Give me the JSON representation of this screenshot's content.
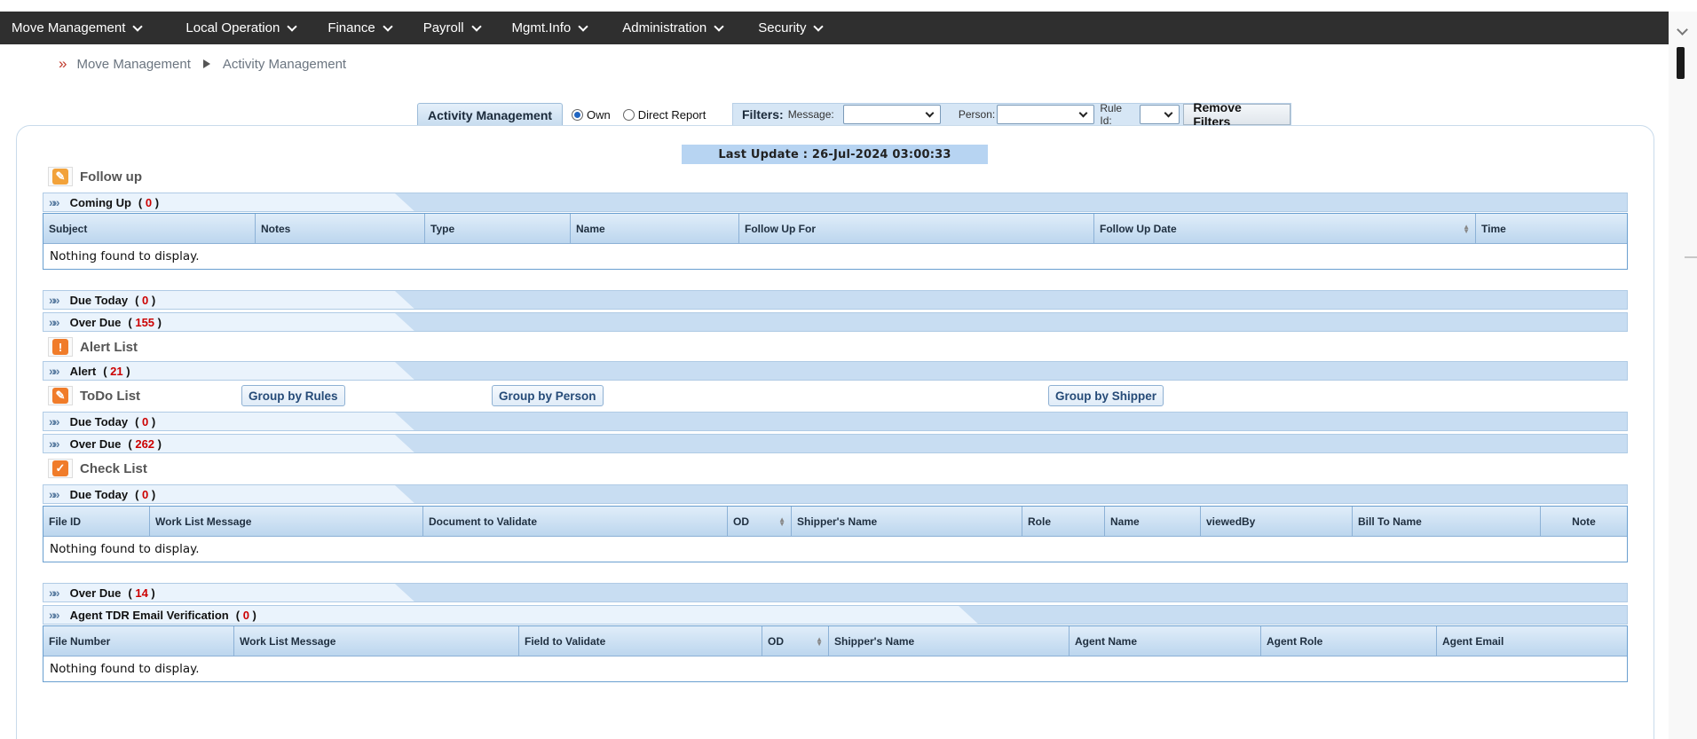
{
  "nav": [
    {
      "label": "Move Management"
    },
    {
      "label": "Local Operation"
    },
    {
      "label": "Finance"
    },
    {
      "label": "Payroll"
    },
    {
      "label": "Mgmt.Info"
    },
    {
      "label": "Administration"
    },
    {
      "label": "Security"
    }
  ],
  "breadcrumb": {
    "root": "Move Management",
    "current": "Activity Management"
  },
  "tabbar": {
    "tab_label": "Activity Management",
    "radio_own": "Own",
    "radio_direct": "Direct Report",
    "radio_selected": "Own",
    "filters_label": "Filters:",
    "message_label": "Message:",
    "person_label": "Person:",
    "rule_label": "Rule Id:",
    "remove_label": "Remove Filters"
  },
  "last_update": "Last Update : 26-Jul-2024 03:00:33",
  "follow_up": {
    "title": "Follow up",
    "coming_up": {
      "label": "Coming Up",
      "count": "0"
    },
    "columns": [
      "Subject",
      "Notes",
      "Type",
      "Name",
      "Follow Up For",
      "Follow Up Date",
      "Time"
    ],
    "empty": "Nothing found to display.",
    "due_today": {
      "label": "Due Today",
      "count": "0"
    },
    "over_due": {
      "label": "Over Due",
      "count": "155"
    }
  },
  "alert_list": {
    "title": "Alert List",
    "alert": {
      "label": "Alert",
      "count": "21"
    }
  },
  "todo_list": {
    "title": "ToDo List",
    "group_rules": "Group by Rules",
    "group_person": "Group by Person",
    "group_shipper": "Group by Shipper",
    "due_today": {
      "label": "Due Today",
      "count": "0"
    },
    "over_due": {
      "label": "Over Due",
      "count": "262"
    }
  },
  "check_list": {
    "title": "Check List",
    "due_today": {
      "label": "Due Today",
      "count": "0"
    },
    "columns": [
      "File ID",
      "Work List Message",
      "Document to Validate",
      "OD",
      "Shipper's Name",
      "Role",
      "Name",
      "viewedBy",
      "Bill To Name",
      "Note"
    ],
    "empty": "Nothing found to display.",
    "over_due": {
      "label": "Over Due",
      "count": "14"
    }
  },
  "agent_tdr": {
    "label": "Agent TDR Email Verification",
    "count": "0",
    "columns": [
      "File Number",
      "Work List Message",
      "Field to Validate",
      "OD",
      "Shipper's Name",
      "Agent Name",
      "Agent Role",
      "Agent Email"
    ],
    "empty": "Nothing found to display."
  },
  "colors": {
    "nav_bg": "#2f2f2f",
    "accent": "#c8ddf2",
    "count_red": "#cc0000",
    "icon_orange": "#f07c2a"
  }
}
